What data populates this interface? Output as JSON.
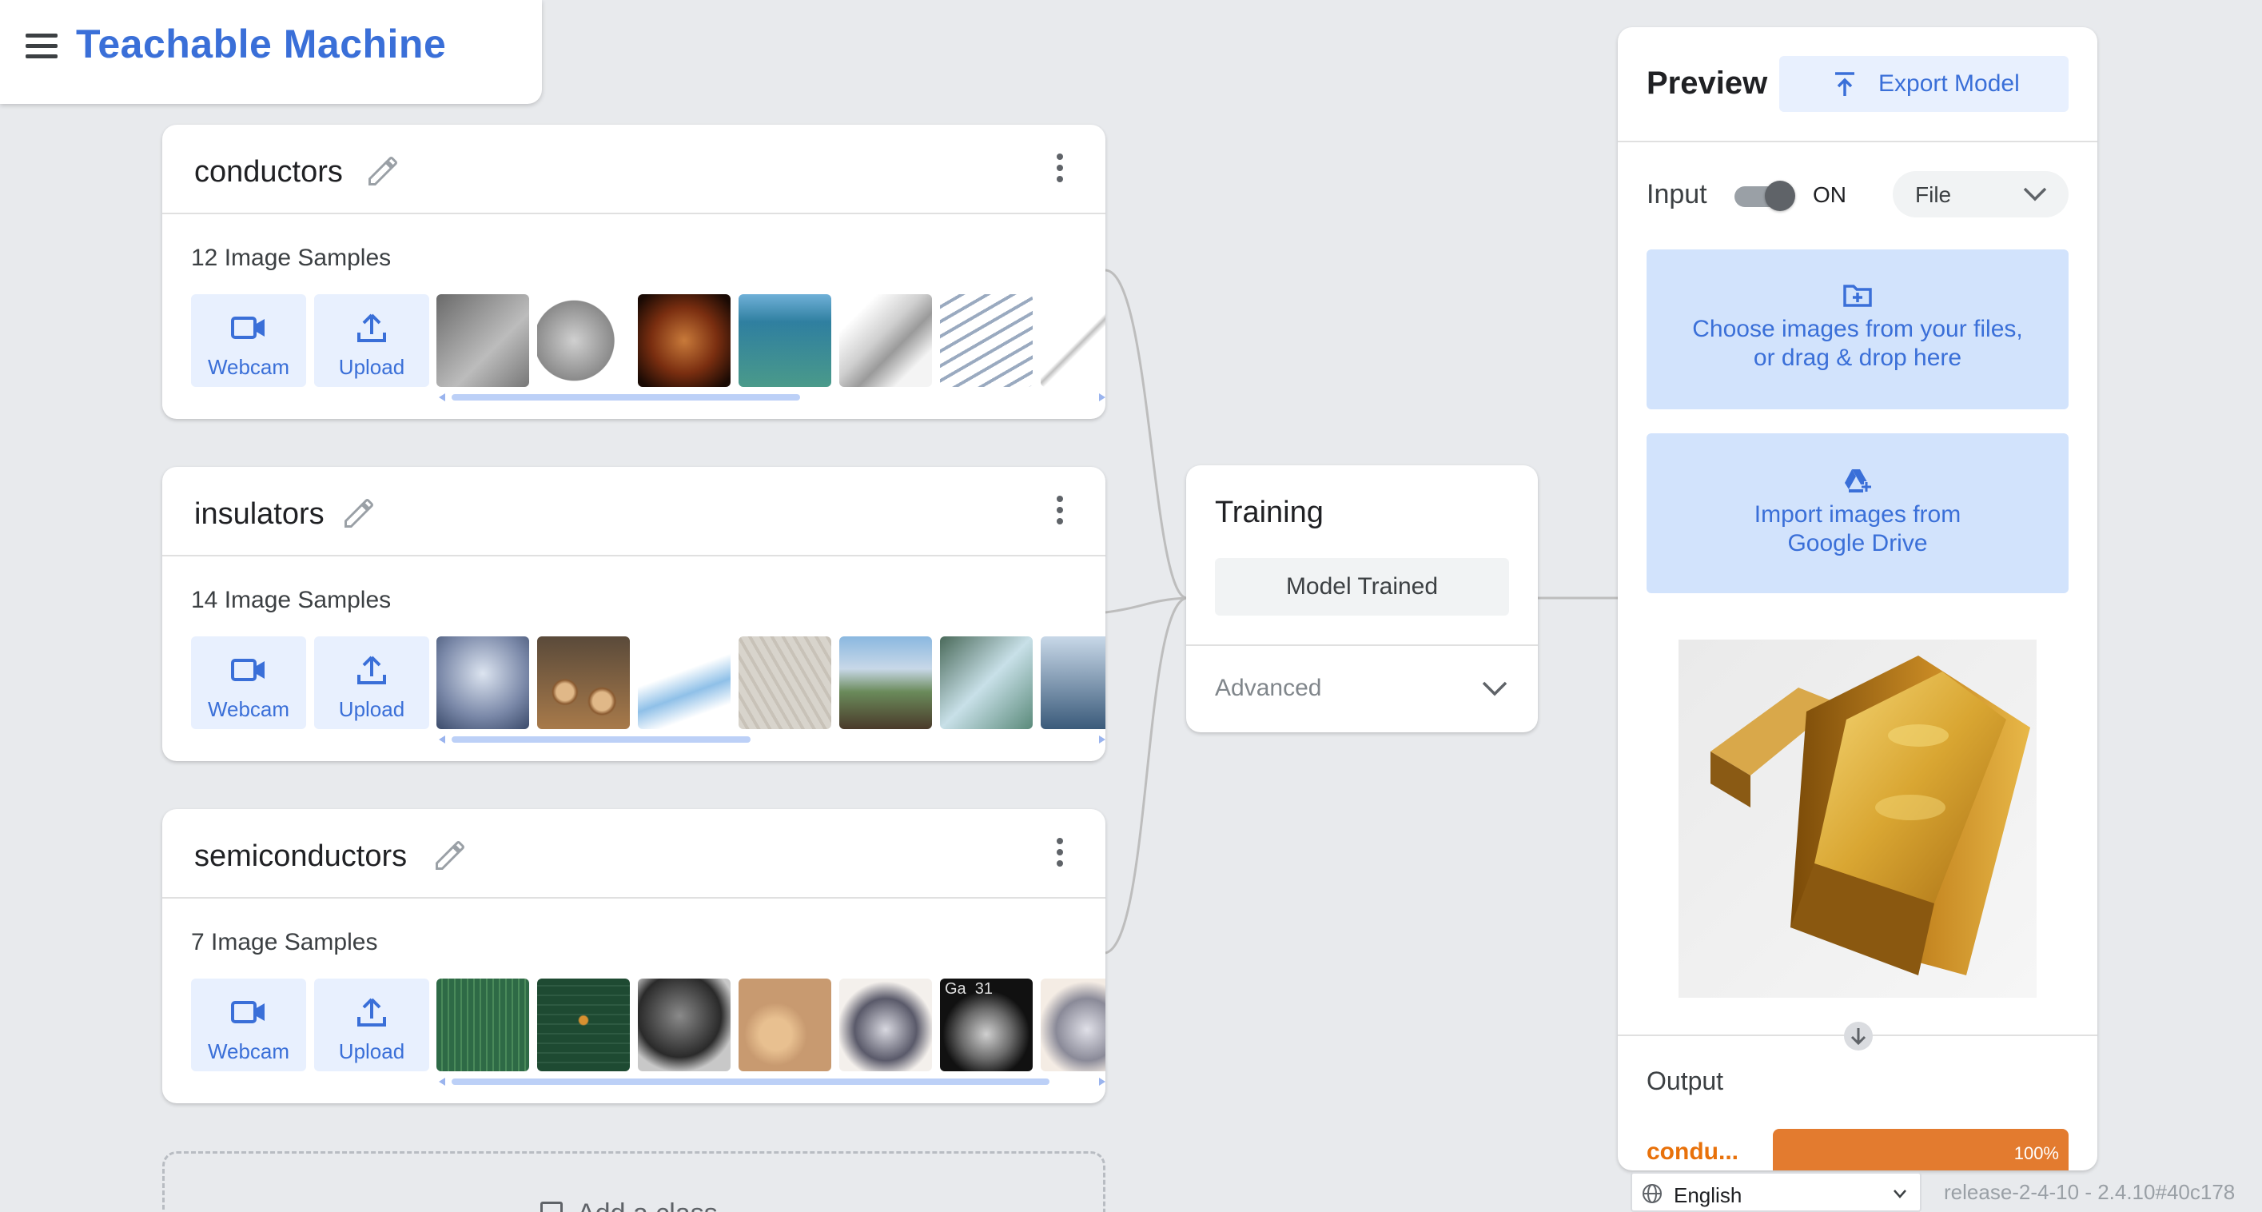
{
  "app": {
    "title": "Teachable Machine"
  },
  "classes": [
    {
      "name": "conductors",
      "samples_label": "12 Image Samples",
      "webcam_label": "Webcam",
      "upload_label": "Upload",
      "thumb_colors": [
        "#8a8a8a",
        "#b0b0b0",
        "#9a4a1e",
        "#3a8fb0",
        "#d8d8d8",
        "#c8d0dc",
        "#eeeeee"
      ],
      "scroll_fraction": 0.43
    },
    {
      "name": "insulators",
      "samples_label": "14 Image Samples",
      "webcam_label": "Webcam",
      "upload_label": "Upload",
      "thumb_colors": [
        "#a8b4c8",
        "#a97848",
        "#d6e4f2",
        "#d8d2c8",
        "#6a8aa8",
        "#7fa890",
        "#4a6a8a"
      ],
      "scroll_fraction": 0.37
    },
    {
      "name": "semiconductors",
      "samples_label": "7 Image Samples",
      "webcam_label": "Webcam",
      "upload_label": "Upload",
      "thumb_colors": [
        "#2e5e3e",
        "#1e4a32",
        "#3a3a3a",
        "#c89a70",
        "#8a8a90",
        "#111111",
        "#9a9aa0"
      ],
      "thumb_texts": [
        "",
        "",
        "",
        "",
        "",
        "Ga  31",
        ""
      ],
      "scroll_fraction": 0.74
    }
  ],
  "add_class": {
    "label": "Add a class"
  },
  "training": {
    "title": "Training",
    "button_label": "Model Trained",
    "advanced_label": "Advanced"
  },
  "preview": {
    "title": "Preview",
    "export_label": "Export Model",
    "input_label": "Input",
    "toggle_state": "ON",
    "source_select": "File",
    "choose_text_1": "Choose images from your files,",
    "choose_text_2": "or drag & drop here",
    "drive_text_1": "Import images from",
    "drive_text_2": "Google Drive",
    "output_title": "Output",
    "output_class": "condu...",
    "output_percent": "100%",
    "output_value": 1.0
  },
  "footer": {
    "language": "English",
    "release": "release-2-4-10 - 2.4.10#40c178"
  },
  "colors": {
    "accent": "#3a6fd8",
    "accent_light": "#e8f0fe",
    "output_orange": "#e37b2f",
    "background": "#e8eaed"
  }
}
